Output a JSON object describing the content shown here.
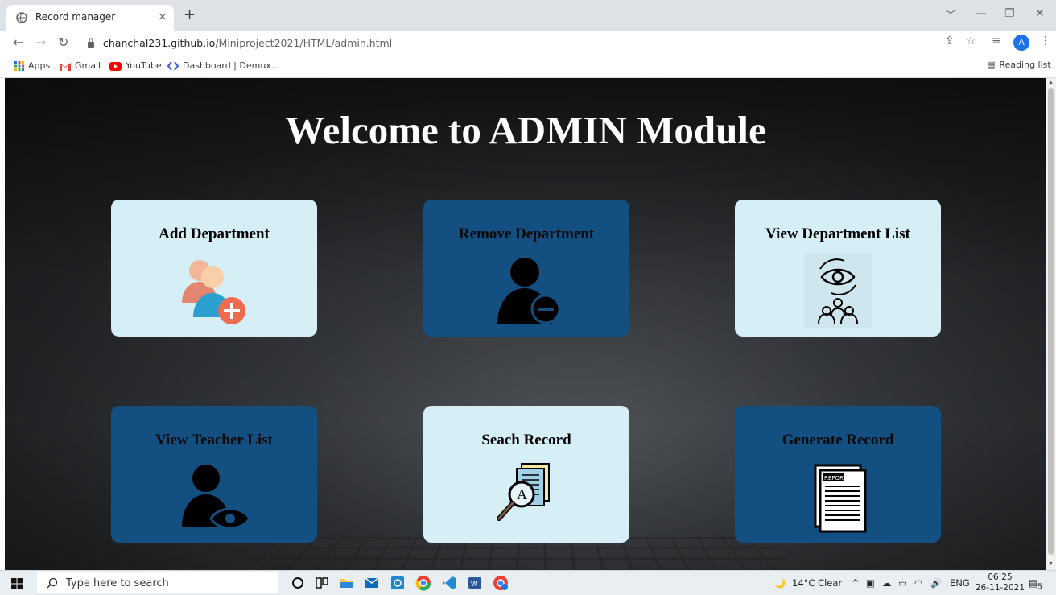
{
  "browser": {
    "tab_title": "Record manager",
    "tab_close": "×",
    "new_tab": "+",
    "url_host": "chanchal231.github.io",
    "url_path": "/Miniproject2021/HTML/admin.html",
    "profile_initial": "A",
    "bookmarks": [
      "Apps",
      "Gmail",
      "YouTube",
      "Dashboard | Demux..."
    ],
    "reading_list": "Reading list"
  },
  "page": {
    "title": "Welcome to ADMIN Module",
    "cards": [
      {
        "label": "Add Department",
        "icon": "add-user-icon",
        "theme": "light"
      },
      {
        "label": "Remove Department",
        "icon": "remove-user-icon",
        "theme": "dark"
      },
      {
        "label": "View Department List",
        "icon": "view-group-icon",
        "theme": "light"
      },
      {
        "label": "View Teacher List",
        "icon": "view-user-icon",
        "theme": "dark"
      },
      {
        "label": "Seach Record",
        "icon": "search-document-icon",
        "theme": "light"
      },
      {
        "label": "Generate Record",
        "icon": "report-icon",
        "theme": "dark"
      }
    ]
  },
  "taskbar": {
    "search_placeholder": "Type here to search",
    "weather": "14°C Clear",
    "language": "ENG",
    "time": "06:25",
    "date": "26-11-2021",
    "notifications": "5"
  },
  "colors": {
    "card_light": "#d6eef6",
    "card_dark": "#134f80",
    "page_title": "#ffffff"
  }
}
